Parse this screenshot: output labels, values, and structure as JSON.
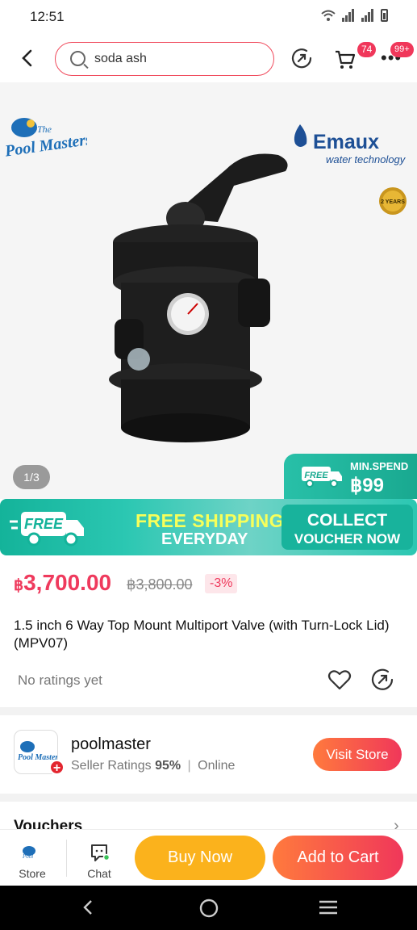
{
  "status_bar": {
    "time": "12:51"
  },
  "search": {
    "value": "soda ash"
  },
  "header": {
    "cart_badge": "74",
    "more_badge": "99+"
  },
  "gallery": {
    "pager": "1/3",
    "logo_left": "The Pool Masters",
    "logo_right_brand": "Emaux",
    "logo_right_tagline": "water technology",
    "warranty_badge": "2 YEARS",
    "promo_free": "FREE",
    "promo_label": "MIN.SPEND",
    "promo_value": "฿99"
  },
  "banner": {
    "free_icon_text": "FREE",
    "headline": "FREE SHIPPING",
    "subline": "EVERYDAY",
    "collect_line1": "COLLECT",
    "collect_line2": "VOUCHER NOW"
  },
  "product": {
    "currency": "฿",
    "price": "3,700.00",
    "original_price": "฿3,800.00",
    "discount": "-3%",
    "title": "1.5 inch 6 Way Top Mount Multiport Valve (with Turn-Lock Lid) (MPV07)",
    "ratings": "No ratings yet"
  },
  "store": {
    "name": "poolmaster",
    "ratings_label": "Seller Ratings",
    "ratings_value": "95%",
    "separator": "|",
    "status": "Online",
    "visit_label": "Visit Store"
  },
  "vouchers": {
    "label": "Vouchers"
  },
  "actions": {
    "store_label": "Store",
    "chat_label": "Chat",
    "buy_now": "Buy Now",
    "add_to_cart": "Add to Cart"
  },
  "colors": {
    "accent": "#f0375a",
    "teal": "#1fb49c",
    "buy_now": "#fbb21c"
  }
}
